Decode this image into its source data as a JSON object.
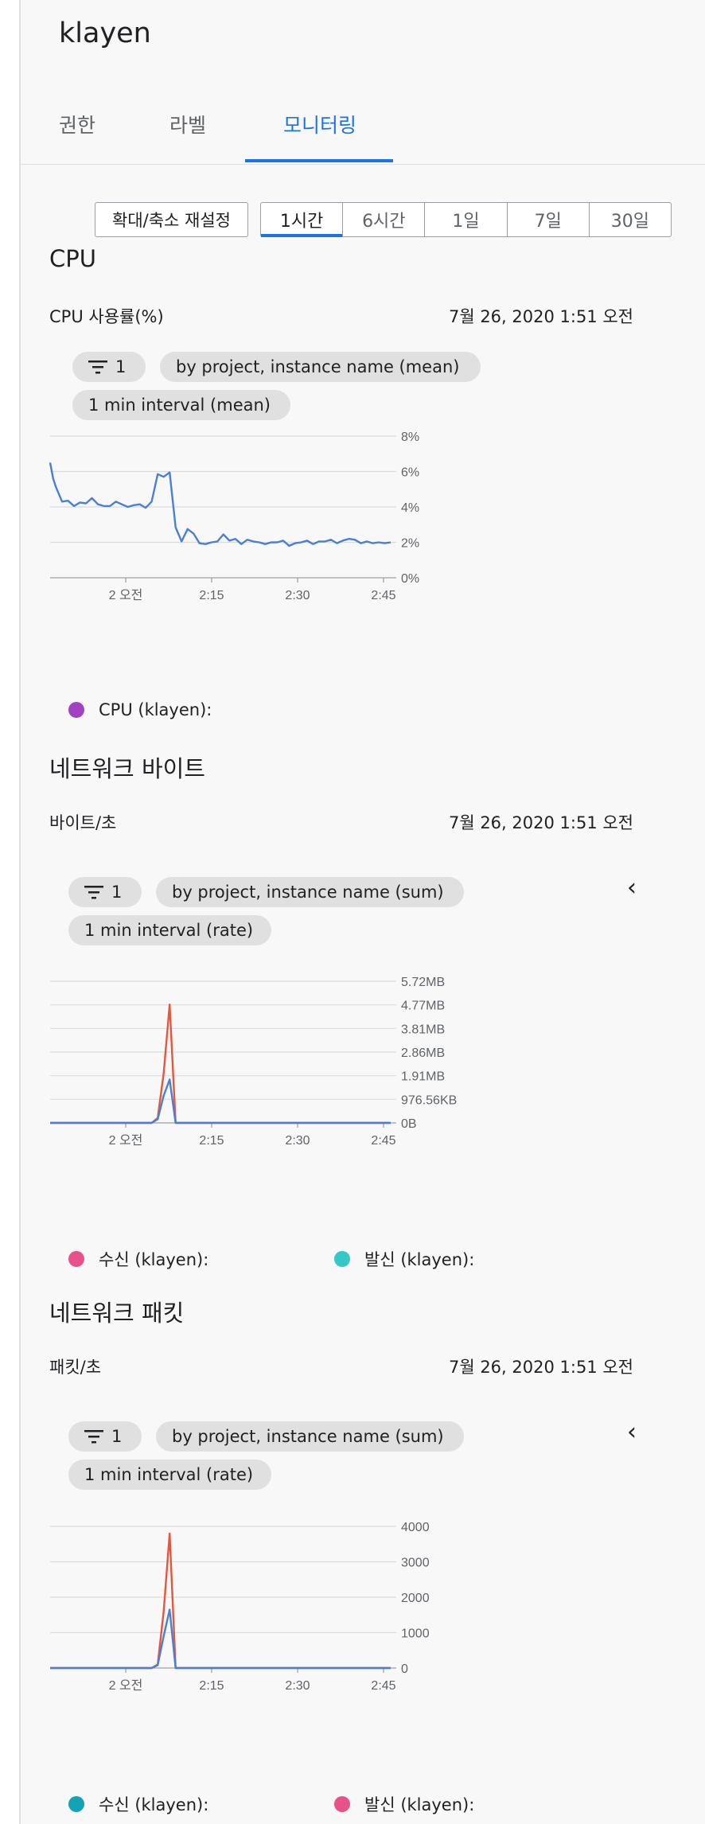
{
  "instance_name": "klayen",
  "tabs": [
    {
      "label": "권한"
    },
    {
      "label": "라벨"
    },
    {
      "label": "모니터링",
      "active": true
    }
  ],
  "time_controls": {
    "reset_label": "확대/축소 재설정",
    "ranges": [
      "1시간",
      "6시간",
      "1일",
      "7일",
      "30일"
    ],
    "selected": "1시간"
  },
  "colors": {
    "accent": "#1a73e8",
    "series_blue": "#4a7fd6",
    "series_orange": "#e8553b",
    "legend_purple": "#a142c2",
    "legend_pink": "#e8528a",
    "legend_teal": "#34c9c3",
    "legend_dark_teal": "#12a4b4"
  },
  "x_tick_labels": [
    "2 오전",
    "2:15",
    "2:30",
    "2:45"
  ],
  "cpu": {
    "title": "CPU",
    "metric": "CPU 사용률(%)",
    "timestamp": "7월 26, 2020 1:51 오전",
    "filter_count": "1",
    "group_chip": "by project, instance name (mean)",
    "interval_chip": "1 min interval (mean)",
    "legend": [
      {
        "label": "CPU (klayen):",
        "color": "#a142c2"
      }
    ]
  },
  "net_bytes": {
    "title": "네트워크 바이트",
    "metric": "바이트/초",
    "timestamp": "7월 26, 2020 1:51 오전",
    "filter_count": "1",
    "group_chip": "by project, instance name (sum)",
    "interval_chip": "1 min interval (rate)",
    "legend": [
      {
        "label": "수신 (klayen):",
        "color": "#e8528a"
      },
      {
        "label": "발신 (klayen):",
        "color": "#34c9c3"
      }
    ]
  },
  "net_packets": {
    "title": "네트워크 패킷",
    "metric": "패킷/초",
    "timestamp": "7월 26, 2020 1:51 오전",
    "filter_count": "1",
    "group_chip": "by project, instance name (sum)",
    "interval_chip": "1 min interval (rate)",
    "legend": [
      {
        "label": "수신 (klayen):",
        "color": "#12a4b4"
      },
      {
        "label": "발신 (klayen):",
        "color": "#e8528a"
      }
    ]
  },
  "chart_data": [
    {
      "type": "line",
      "ylabel": "CPU 사용률(%)",
      "y_ticks": [
        "8%",
        "6%",
        "4%",
        "2%",
        "0%"
      ],
      "ylim": [
        0,
        8
      ],
      "x_ticks": [
        "2 오전",
        "2:15",
        "2:30",
        "2:45"
      ],
      "grid": true,
      "series": [
        {
          "color": "#4a7fd6",
          "x": [
            0,
            0.5,
            1,
            2,
            3,
            4,
            5,
            6,
            7,
            8,
            9,
            10,
            11,
            12,
            13,
            14,
            15,
            16,
            17,
            18,
            19,
            20,
            21,
            22,
            23,
            24,
            25,
            26,
            27,
            28,
            29,
            30,
            31,
            32,
            33,
            34,
            35,
            36,
            37,
            38,
            39,
            40,
            41,
            42,
            43,
            44,
            45,
            46,
            47,
            48,
            49,
            50,
            51,
            52,
            53,
            54,
            55,
            56,
            57
          ],
          "y": [
            6.5,
            5.6,
            5.1,
            4.3,
            4.35,
            4.05,
            4.25,
            4.2,
            4.5,
            4.15,
            4.05,
            4.05,
            4.3,
            4.15,
            4.0,
            4.1,
            4.15,
            3.95,
            4.3,
            5.85,
            5.7,
            5.95,
            2.85,
            2.05,
            2.75,
            2.5,
            1.95,
            1.9,
            2.0,
            2.05,
            2.45,
            2.1,
            2.2,
            1.9,
            2.15,
            2.05,
            2.0,
            1.9,
            2.0,
            2.0,
            2.1,
            1.8,
            1.95,
            2.0,
            2.1,
            1.9,
            2.05,
            2.05,
            2.15,
            1.95,
            2.1,
            2.2,
            2.15,
            1.95,
            2.05,
            1.95,
            2.0,
            1.95,
            2.0
          ]
        }
      ]
    },
    {
      "type": "line",
      "ylabel": "바이트/초",
      "y_ticks": [
        "5.72MB",
        "4.77MB",
        "3.81MB",
        "2.86MB",
        "1.91MB",
        "976.56KB",
        "0B"
      ],
      "ylim": [
        0,
        5.72
      ],
      "x_ticks": [
        "2 오전",
        "2:15",
        "2:30",
        "2:45"
      ],
      "grid": true,
      "series": [
        {
          "name": "수신 (klayen):",
          "color": "#e8553b",
          "x": [
            0,
            17,
            18,
            19,
            20,
            21,
            57
          ],
          "y": [
            0,
            0,
            0.2,
            2.0,
            4.78,
            0,
            0
          ]
        },
        {
          "name": "발신 (klayen):",
          "color": "#4a7fd6",
          "x": [
            0,
            17,
            18,
            19,
            20,
            21,
            57
          ],
          "y": [
            0,
            0,
            0.15,
            1.1,
            1.75,
            0,
            0
          ]
        }
      ]
    },
    {
      "type": "line",
      "ylabel": "패킷/초",
      "y_ticks": [
        "4000",
        "3000",
        "2000",
        "1000",
        "0"
      ],
      "ylim": [
        0,
        4000
      ],
      "x_ticks": [
        "2 오전",
        "2:15",
        "2:30",
        "2:45"
      ],
      "grid": true,
      "series": [
        {
          "name": "발신 (klayen):",
          "color": "#e8553b",
          "x": [
            0,
            17,
            18,
            19,
            20,
            21,
            57
          ],
          "y": [
            0,
            0,
            100,
            1600,
            3800,
            0,
            0
          ]
        },
        {
          "name": "수신 (klayen):",
          "color": "#4a7fd6",
          "x": [
            0,
            17,
            18,
            19,
            20,
            21,
            57
          ],
          "y": [
            0,
            0,
            80,
            900,
            1650,
            0,
            0
          ]
        }
      ]
    }
  ]
}
